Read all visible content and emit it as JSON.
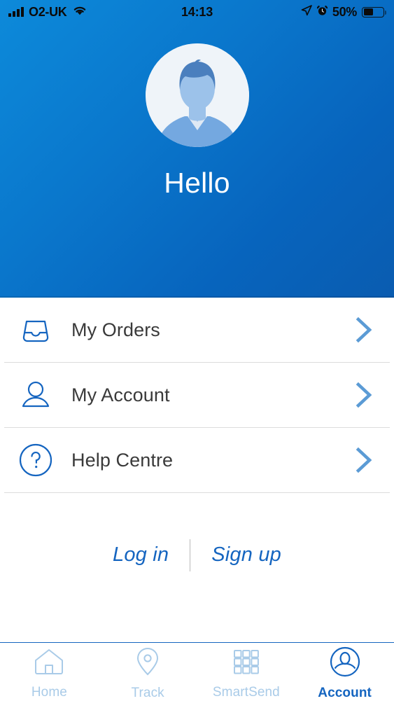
{
  "status_bar": {
    "carrier": "O2-UK",
    "time": "14:13",
    "battery_percent": "50%",
    "battery_level": 50,
    "icons": [
      "signal-bars-icon",
      "wifi-icon",
      "location-arrow-icon",
      "alarm-clock-icon",
      "battery-icon"
    ]
  },
  "header": {
    "greeting": "Hello",
    "avatar_alt": "user-avatar",
    "gradient_start": "#0d8ada",
    "gradient_end": "#0a5cb0"
  },
  "menu": {
    "items": [
      {
        "label": "My Orders",
        "icon": "inbox-tray-icon",
        "chevron": "chevron-right-icon"
      },
      {
        "label": "My Account",
        "icon": "person-outline-icon",
        "chevron": "chevron-right-icon"
      },
      {
        "label": "Help Centre",
        "icon": "question-circle-icon",
        "chevron": "chevron-right-icon"
      }
    ]
  },
  "auth": {
    "login_label": "Log in",
    "signup_label": "Sign up",
    "link_color": "#1565c0"
  },
  "tabbar": {
    "active_color": "#1565c0",
    "inactive_color": "#a9cbe8",
    "items": [
      {
        "label": "Home",
        "icon": "home-icon",
        "active": false
      },
      {
        "label": "Track",
        "icon": "map-pin-icon",
        "active": false
      },
      {
        "label": "SmartSend",
        "icon": "grid-icon",
        "active": false
      },
      {
        "label": "Account",
        "icon": "account-circle-icon",
        "active": true
      }
    ]
  }
}
